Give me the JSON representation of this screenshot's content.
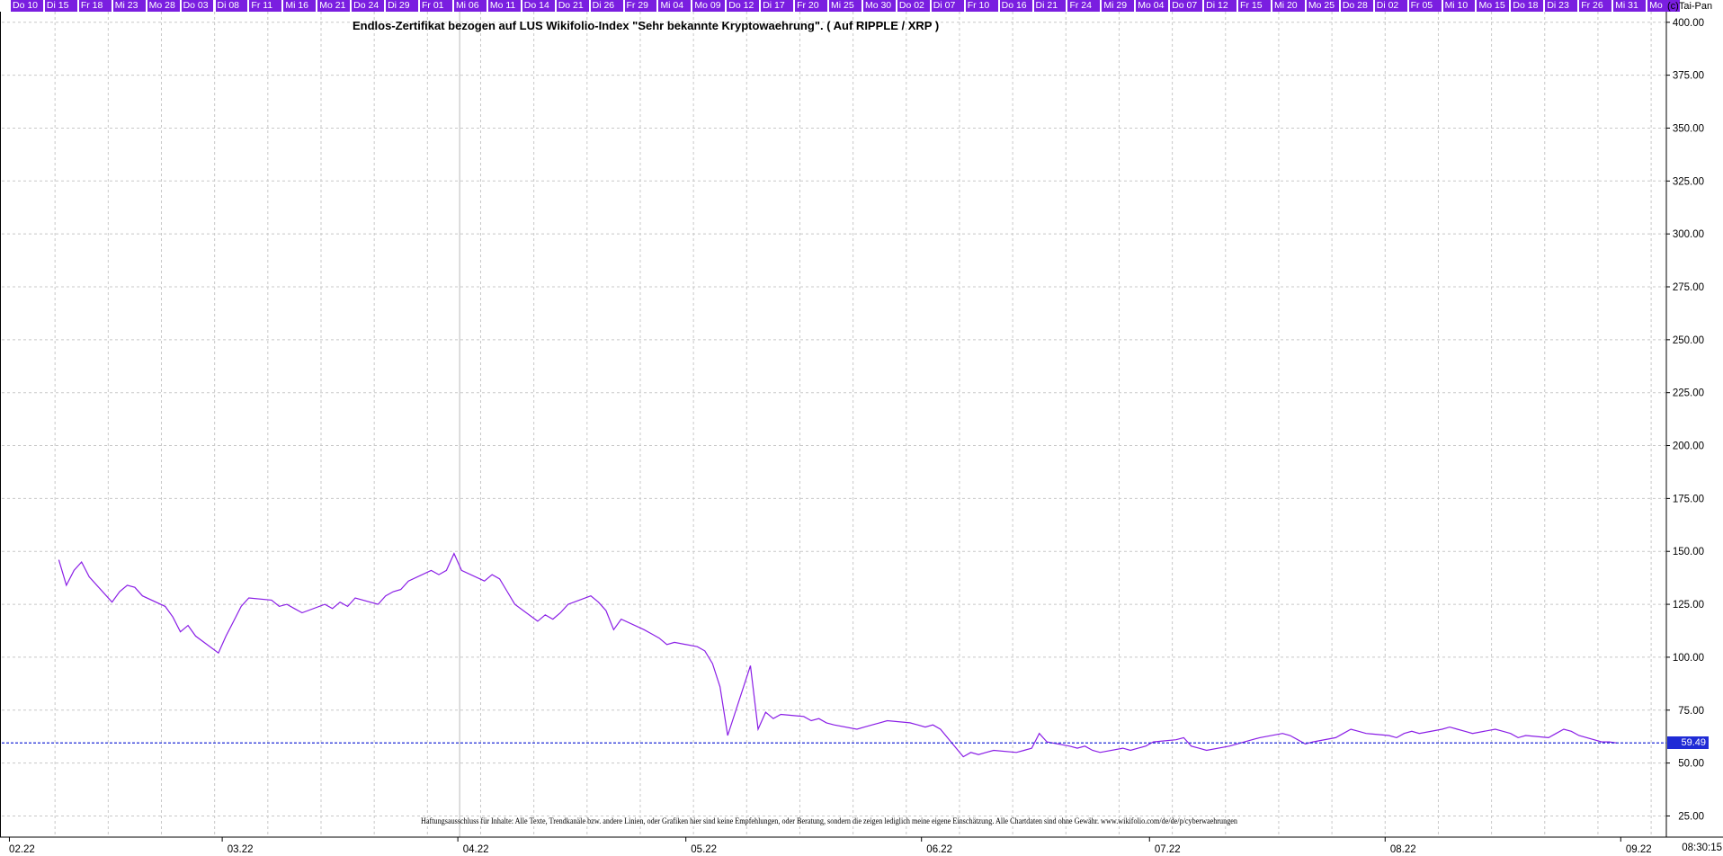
{
  "header": {
    "day_labels": [
      "Do 10",
      "Di 15",
      "Fr 18",
      "Mi 23",
      "Mo 28",
      "Do 03",
      "Di 08",
      "Fr 11",
      "Mi 16",
      "Mo 21",
      "Do 24",
      "Di 29",
      "Fr 01",
      "Mi 06",
      "Mo 11",
      "Do 14",
      "Do 21",
      "Di 26",
      "Fr 29",
      "Mi 04",
      "Mo 09",
      "Do 12",
      "Di 17",
      "Fr 20",
      "Mi 25",
      "Mo 30",
      "Do 02",
      "Di 07",
      "Fr 10",
      "Do 16",
      "Di 21",
      "Fr 24",
      "Mi 29",
      "Mo 04",
      "Do 07",
      "Di 12",
      "Fr 15",
      "Mi 20",
      "Mo 25",
      "Do 28",
      "Di 02",
      "Fr 05",
      "Mi 10",
      "Mo 15",
      "Do 18",
      "Di 23",
      "Fr 26",
      "Mi 31",
      "Mo"
    ],
    "copyright": "(c)Tai-Pan",
    "colors": {
      "day_bg": "#7a1ee0",
      "day_text": "#ffffff"
    }
  },
  "chart_data": {
    "type": "line",
    "title": "Endlos-Zertifikat bezogen auf LUS Wikifolio-Index \"Sehr bekannte Kryptowaehrung\". ( Auf RIPPLE / XRP )",
    "xlabel": "",
    "ylabel": "",
    "x_tick_labels": [
      "02.22",
      "03.22",
      "04.22",
      "05.22",
      "06.22",
      "07.22",
      "08.22",
      "09.22"
    ],
    "y_ticks": [
      25,
      50,
      75,
      100,
      125,
      150,
      175,
      200,
      225,
      250,
      275,
      300,
      325,
      350,
      375,
      400
    ],
    "y_tick_labels": [
      "25.00",
      "50.00",
      "75.00",
      "100.00",
      "125.00",
      "150.00",
      "175.00",
      "200.00",
      "225.00",
      "250.00",
      "275.00",
      "300.00",
      "325.00",
      "350.00",
      "375.00",
      "400.00"
    ],
    "ylim": [
      15,
      405
    ],
    "grid": true,
    "line_color": "#8a1ee6",
    "last_value": 59.49,
    "last_value_label": "59.49",
    "last_value_color": "#1f2bd6",
    "x": [
      "2022-02-07",
      "2022-02-08",
      "2022-02-09",
      "2022-02-10",
      "2022-02-11",
      "2022-02-14",
      "2022-02-15",
      "2022-02-16",
      "2022-02-17",
      "2022-02-18",
      "2022-02-21",
      "2022-02-22",
      "2022-02-23",
      "2022-02-24",
      "2022-02-25",
      "2022-02-28",
      "2022-03-01",
      "2022-03-02",
      "2022-03-03",
      "2022-03-04",
      "2022-03-07",
      "2022-03-08",
      "2022-03-09",
      "2022-03-10",
      "2022-03-11",
      "2022-03-14",
      "2022-03-15",
      "2022-03-16",
      "2022-03-17",
      "2022-03-18",
      "2022-03-21",
      "2022-03-22",
      "2022-03-23",
      "2022-03-24",
      "2022-03-25",
      "2022-03-28",
      "2022-03-29",
      "2022-03-30",
      "2022-03-31",
      "2022-04-01",
      "2022-04-04",
      "2022-04-05",
      "2022-04-06",
      "2022-04-07",
      "2022-04-08",
      "2022-04-11",
      "2022-04-12",
      "2022-04-13",
      "2022-04-14",
      "2022-04-15",
      "2022-04-18",
      "2022-04-19",
      "2022-04-20",
      "2022-04-21",
      "2022-04-22",
      "2022-04-25",
      "2022-04-26",
      "2022-04-27",
      "2022-04-28",
      "2022-04-29",
      "2022-05-02",
      "2022-05-03",
      "2022-05-04",
      "2022-05-05",
      "2022-05-06",
      "2022-05-09",
      "2022-05-10",
      "2022-05-11",
      "2022-05-12",
      "2022-05-13",
      "2022-05-16",
      "2022-05-17",
      "2022-05-18",
      "2022-05-19",
      "2022-05-20",
      "2022-05-23",
      "2022-05-24",
      "2022-05-25",
      "2022-05-26",
      "2022-05-27",
      "2022-05-30",
      "2022-05-31",
      "2022-06-01",
      "2022-06-02",
      "2022-06-03",
      "2022-06-06",
      "2022-06-07",
      "2022-06-08",
      "2022-06-09",
      "2022-06-10",
      "2022-06-13",
      "2022-06-14",
      "2022-06-15",
      "2022-06-16",
      "2022-06-17",
      "2022-06-20",
      "2022-06-21",
      "2022-06-22",
      "2022-06-23",
      "2022-06-24",
      "2022-06-27",
      "2022-06-28",
      "2022-06-29",
      "2022-06-30",
      "2022-07-01",
      "2022-07-04",
      "2022-07-05",
      "2022-07-06",
      "2022-07-07",
      "2022-07-08",
      "2022-07-11",
      "2022-07-12",
      "2022-07-13",
      "2022-07-14",
      "2022-07-15",
      "2022-07-18",
      "2022-07-19",
      "2022-07-20",
      "2022-07-21",
      "2022-07-22",
      "2022-07-25",
      "2022-07-26",
      "2022-07-27",
      "2022-07-28",
      "2022-07-29",
      "2022-08-01",
      "2022-08-02",
      "2022-08-03",
      "2022-08-04",
      "2022-08-05",
      "2022-08-08",
      "2022-08-09",
      "2022-08-10",
      "2022-08-11",
      "2022-08-12",
      "2022-08-15",
      "2022-08-16",
      "2022-08-17",
      "2022-08-18",
      "2022-08-19",
      "2022-08-22",
      "2022-08-23",
      "2022-08-24",
      "2022-08-25",
      "2022-08-26",
      "2022-08-29",
      "2022-08-30",
      "2022-08-31",
      "2022-09-01",
      "2022-09-02",
      "2022-09-05"
    ],
    "values": [
      146,
      134,
      141,
      145,
      138,
      126,
      131,
      134,
      133,
      129,
      124,
      119,
      112,
      115,
      110,
      102,
      110,
      117,
      124,
      128,
      127,
      124,
      125,
      123,
      121,
      125,
      123,
      126,
      124,
      128,
      125,
      129,
      131,
      132,
      136,
      141,
      139,
      141,
      149,
      141,
      136,
      139,
      137,
      131,
      125,
      117,
      120,
      118,
      121,
      125,
      129,
      126,
      122,
      113,
      118,
      113,
      111,
      109,
      106,
      107,
      105,
      103,
      97,
      86,
      63,
      96,
      66,
      74,
      71,
      73,
      72,
      70,
      71,
      69,
      68,
      66,
      67,
      68,
      69,
      70,
      69,
      68,
      67,
      68,
      66,
      53,
      55,
      54,
      55,
      56,
      55,
      56,
      57,
      64,
      60,
      58,
      57,
      58,
      56,
      55,
      57,
      56,
      57,
      58,
      60,
      61,
      62,
      58,
      57,
      56,
      58,
      59,
      60,
      61,
      62,
      64,
      63,
      61,
      59,
      60,
      62,
      64,
      66,
      65,
      64,
      63,
      62,
      64,
      65,
      64,
      66,
      67,
      66,
      65,
      64,
      66,
      65,
      64,
      62,
      63,
      62,
      64,
      66,
      65,
      63,
      60,
      60,
      59.49
    ]
  },
  "footer": {
    "disclaimer": "Haftungsausschluss für Inhalte: Alle Texte, Trendkanäle bzw. andere Linien, oder Grafiken hier sind keine Empfehlungen, oder Beratung, sondern die zeigen lediglich meine eigene Einschätzung. Alle Chartdaten sind ohne Gewähr.  www.wikifolio.com/de/de/p/cyberwaehrungen",
    "timestamp": "08:30:15"
  }
}
